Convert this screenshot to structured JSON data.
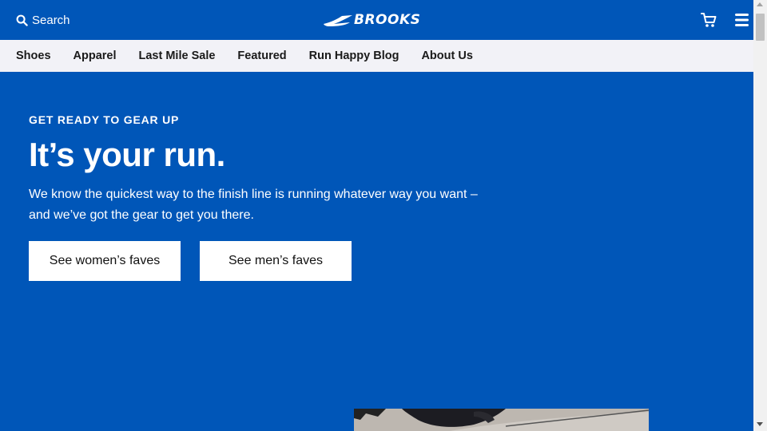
{
  "header": {
    "search_label": "Search",
    "logo_text": "BROOKS"
  },
  "nav": {
    "items": [
      {
        "label": "Shoes"
      },
      {
        "label": "Apparel"
      },
      {
        "label": "Last Mile Sale"
      },
      {
        "label": "Featured"
      },
      {
        "label": "Run Happy Blog"
      },
      {
        "label": "About Us"
      }
    ]
  },
  "hero": {
    "eyebrow": "GET READY TO GEAR UP",
    "headline": "It’s your run.",
    "body": "We know the quickest way to the finish line is running whatever way you want – and we’ve got the gear to get you there.",
    "cta_women": "See women’s faves",
    "cta_men": "See men’s faves"
  },
  "icons": {
    "search": "search-icon",
    "cart": "cart-icon",
    "menu": "hamburger-menu-icon",
    "logo_mark": "brooks-chevron-logo"
  },
  "colors": {
    "brand_blue": "#0056b8",
    "nav_bg": "#f2f2f7",
    "button_bg": "#ffffff"
  }
}
